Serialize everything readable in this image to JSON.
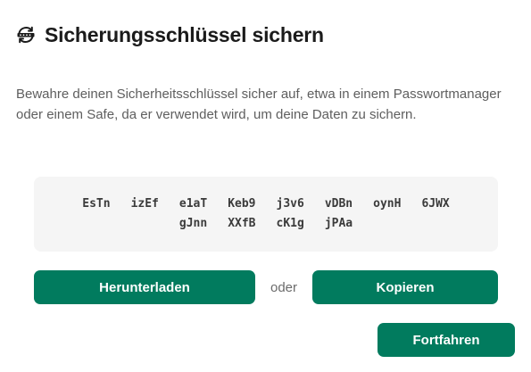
{
  "dialog": {
    "title": "Sicherungsschlüssel sichern",
    "title_icon": "key-sync-icon",
    "description": "Bewahre deinen Sicherheitsschlüssel sicher auf, etwa in einem Passwortmanager oder einem Safe, da er verwendet wird, um deine Daten zu sichern.",
    "key_chunks": [
      "EsTn",
      "izEf",
      "e1aT",
      "Keb9",
      "j3v6",
      "vDBn",
      "oynH",
      "6JWX",
      "gJnn",
      "XXfB",
      "cK1g",
      "jPAa"
    ],
    "download_label": "Herunterladen",
    "or_label": "oder",
    "copy_label": "Kopieren",
    "continue_label": "Fortfahren"
  },
  "colors": {
    "accent": "#017b5e",
    "title": "#1b1b1b",
    "text": "#5e5e5e",
    "key_box_bg": "#f5f5f5"
  }
}
